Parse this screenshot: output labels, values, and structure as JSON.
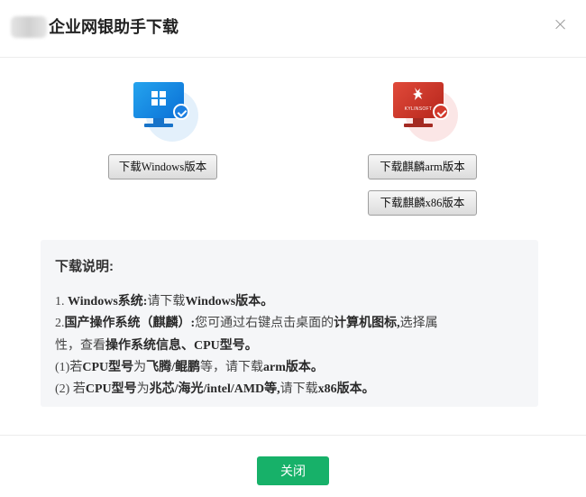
{
  "dialog": {
    "title": "企业网银助手下载"
  },
  "downloads": {
    "windows_label": "下载Windows版本",
    "kylin_arm_label": "下载麒麟arm版本",
    "kylin_x86_label": "下载麒麟x86版本",
    "kylin_brand_text": "KYLINSOFT"
  },
  "instructions": {
    "title": "下载说明:",
    "line1": {
      "p1": "1. ",
      "b1": "Windows系统:",
      "p2": "请下载",
      "b2": "Windows版本。"
    },
    "line2": {
      "p1": "2.",
      "b1": "国产操作系统（麒麟）:",
      "p2": "您可通过右键点击桌面的",
      "b2": "计算机图标,",
      "p3": "选择属"
    },
    "line3": {
      "p1": "性，查看",
      "b1": "操作系统信息、CPU型号。"
    },
    "line4": {
      "p1": "(1)若",
      "b1": "CPU型号",
      "p2": "为",
      "b2": "飞腾/鲲鹏",
      "p3": "等，请下载",
      "b3": "arm版本。"
    },
    "line5": {
      "p1": "(2) 若",
      "b1": "CPU型号",
      "p2": "为",
      "b2": "兆芯/海光/intel/AMD等,",
      "p3": "请下载",
      "b3": "x86版本。"
    }
  },
  "footer": {
    "close_label": "关闭"
  },
  "colors": {
    "primary_green": "#17b169",
    "windows_blue": "#1a7ee0",
    "kylin_red": "#d2392c"
  }
}
